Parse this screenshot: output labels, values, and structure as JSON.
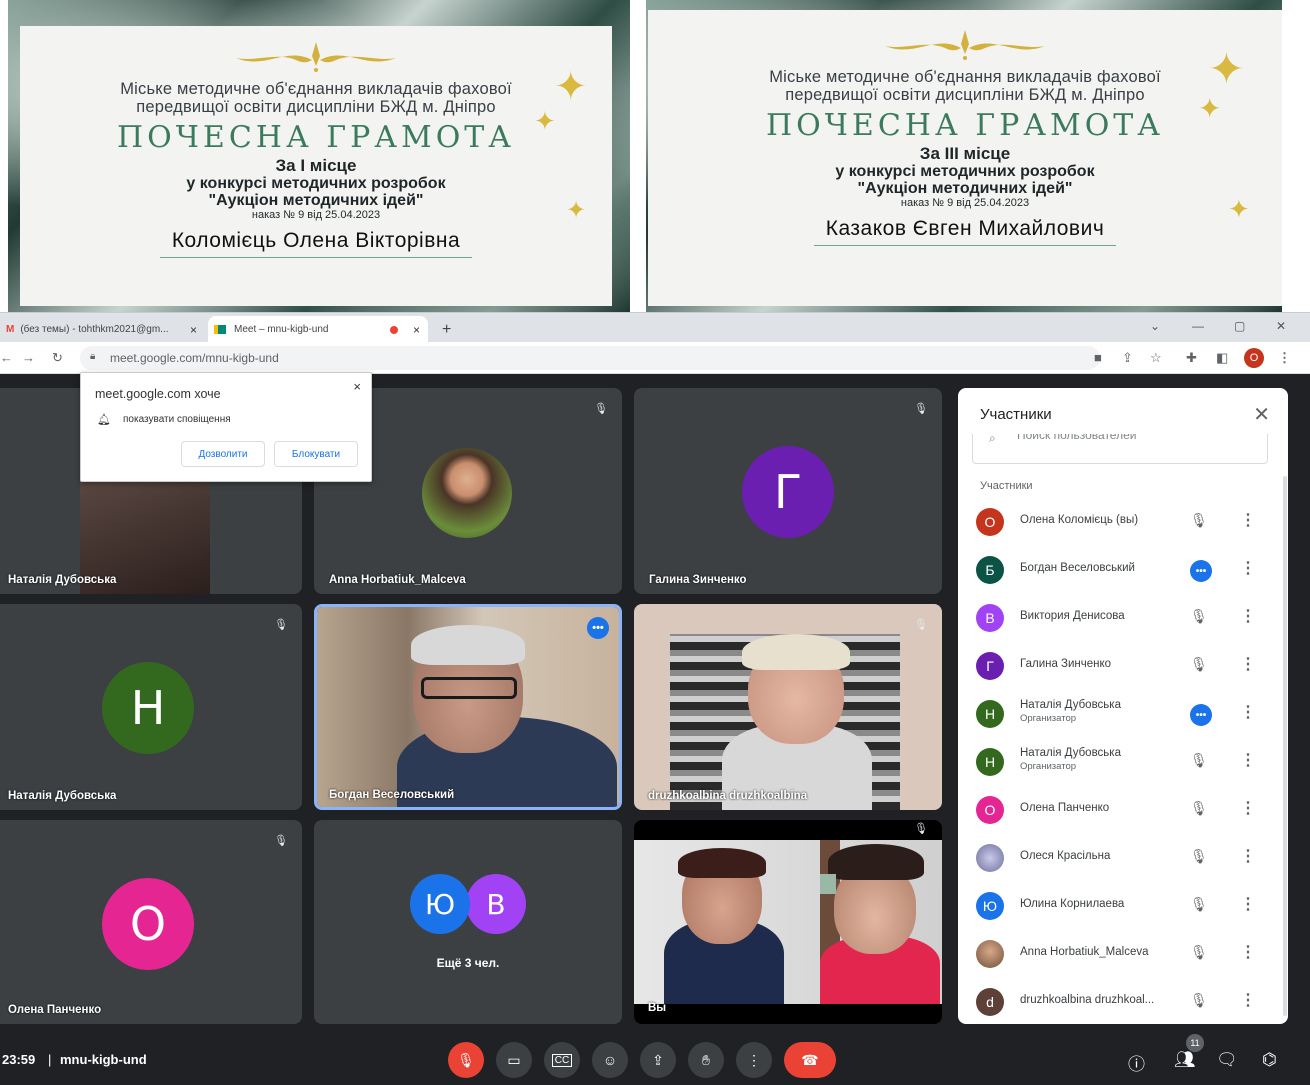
{
  "certificates": [
    {
      "organization_line1": "Міське методичне об'єднання викладачів фахової",
      "organization_line2": "передвищої освіти дисципліни БЖД м. Дніпро",
      "title": "ПОЧЕСНА ГРАМОТА",
      "place": "За І місце",
      "contest_line1": "у конкурсі методичних розробок",
      "contest_line2": "\"Аукціон методичних ідей\"",
      "order": "наказ № 9 від 25.04.2023",
      "recipient": "Коломієць Олена Вікторівна"
    },
    {
      "organization_line1": "Міське методичне об'єднання викладачів фахової",
      "organization_line2": "передвищої освіти дисципліни БЖД м. Дніпро",
      "title": "ПОЧЕСНА ГРАМОТА",
      "place": "За ІІІ місце",
      "contest_line1": "у конкурсі методичних розробок",
      "contest_line2": "\"Аукціон методичних ідей\"",
      "order": "наказ № 9 від 25.04.2023",
      "recipient": "Казаков Євген Михайлович"
    }
  ],
  "browser": {
    "tabs": [
      {
        "label": "(без темы) - tohthkm2021@gm...",
        "close": "×"
      },
      {
        "label": "Meet – mnu-kigb-und",
        "close": "×"
      }
    ],
    "new_tab": "+",
    "window_controls": {
      "dropdown": "⌄",
      "minimize": "—",
      "restore": "▢",
      "close": "✕"
    },
    "url": "meet.google.com/mnu-kigb-und",
    "profile_letter": "О"
  },
  "permission_popup": {
    "title": "meet.google.com хоче",
    "close": "×",
    "text": "показувати сповіщення",
    "allow": "Дозволити",
    "block": "Блокувати"
  },
  "tiles": [
    {
      "name": "Наталія Дубовська"
    },
    {
      "name": "Anna Horbatiuk_Malceva"
    },
    {
      "name": "Галина Зинченко",
      "avatar": "Г"
    },
    {
      "name": "Наталія Дубовська",
      "avatar": "Н"
    },
    {
      "name": "Богдан Веселовський"
    },
    {
      "name": "druzhkoalbina druzhkoalbina"
    },
    {
      "name": "Олена Панченко",
      "avatar": "О"
    },
    {
      "avatar1": "Ю",
      "avatar2": "В",
      "more": "Ещё 3 чел."
    },
    {
      "name": "Вы"
    }
  ],
  "participants_panel": {
    "title": "Участники",
    "close": "✕",
    "search_placeholder": "Поиск пользователей",
    "section": "Участники",
    "items": [
      {
        "avatar": "О",
        "name": "Олена Коломієць (вы)",
        "color": "#c5341c"
      },
      {
        "avatar": "Б",
        "name": "Богдан Веселовський",
        "color": "#0b5345"
      },
      {
        "avatar": "В",
        "name": "Виктория Денисова",
        "color": "#a142f4"
      },
      {
        "avatar": "Г",
        "name": "Галина Зинченко",
        "color": "#6a1fb0"
      },
      {
        "avatar": "Н",
        "name": "Наталія Дубовська",
        "role": "Организатор",
        "color": "#33691e"
      },
      {
        "avatar": "Н",
        "name": "Наталія Дубовська",
        "role": "Организатор",
        "color": "#33691e"
      },
      {
        "avatar": "О",
        "name": "Олена Панченко",
        "color": "#e52592"
      },
      {
        "avatar": "",
        "name": "Олеся Красільна",
        "color": "#7b7fa8"
      },
      {
        "avatar": "Ю",
        "name": "Юлина Корнилаева",
        "color": "#1a73e8"
      },
      {
        "avatar": "",
        "name": "Anna Horbatiuk_Malceva",
        "color": "#8d6e4e"
      },
      {
        "avatar": "d",
        "name": "druzhkoalbina druzhkoal...",
        "color": "#5d4037"
      }
    ]
  },
  "bottom_bar": {
    "time": "23:59",
    "separator": "|",
    "meeting_code": "mnu-kigb-und",
    "participant_count": "11"
  }
}
